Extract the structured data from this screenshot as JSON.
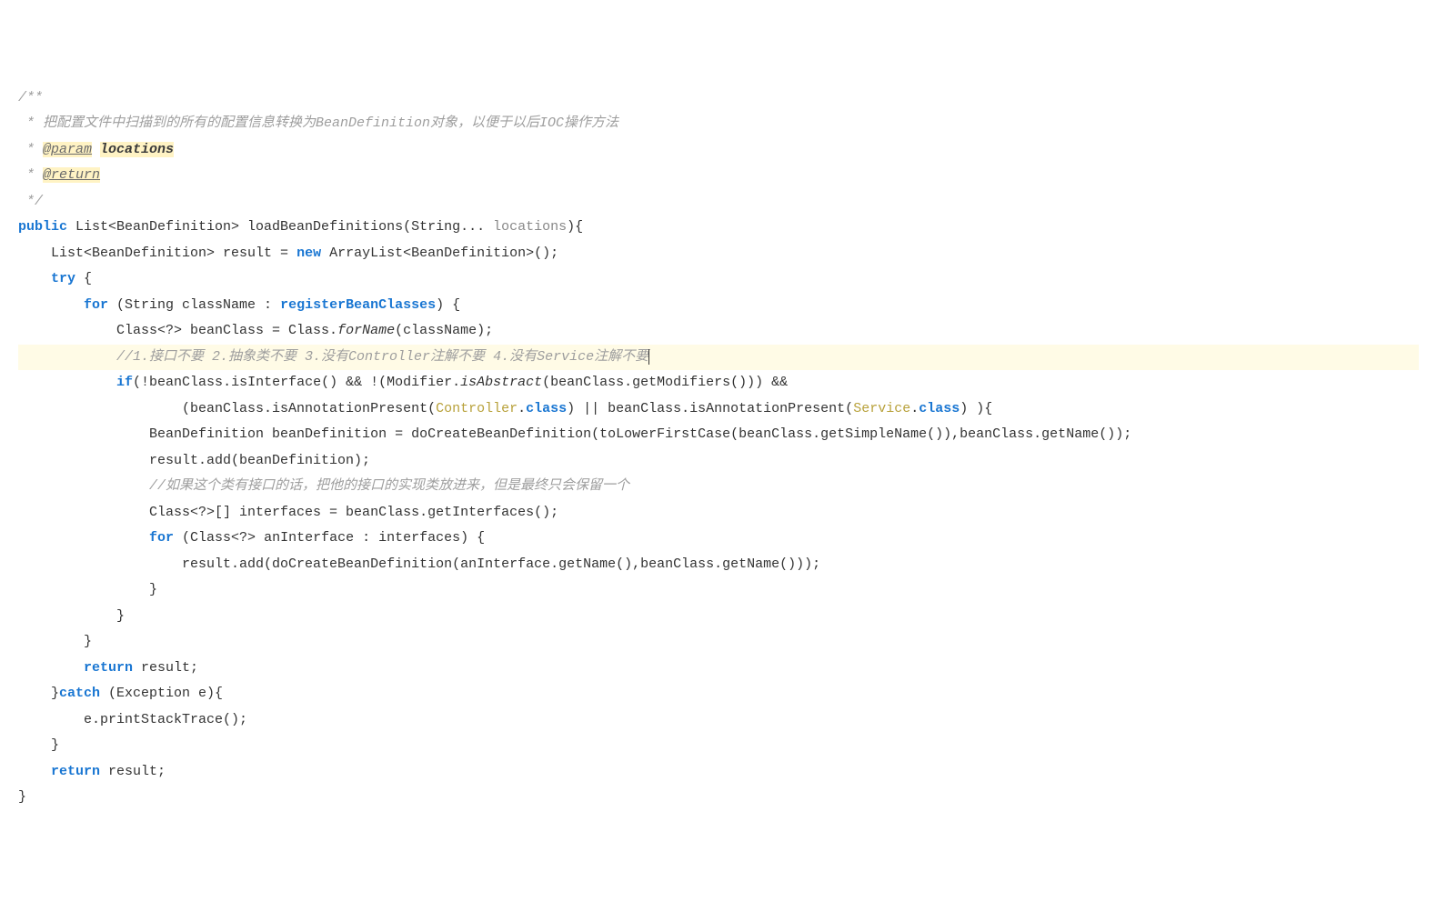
{
  "lines": {
    "l1": "/**",
    "l2_star": " * ",
    "l2_text": "把配置文件中扫描到的所有的配置信息转换为BeanDefinition对象，以便于以后IOC操作方法",
    "l3_star": " * ",
    "l3_tag": "@param",
    "l3_sp": " ",
    "l3_param": "locations",
    "l4_star": " * ",
    "l4_tag": "@return",
    "l5": " */",
    "l6_kw": "public",
    "l6_a": " List<BeanDefinition> loadBeanDefinitions(String... ",
    "l6_p": "locations",
    "l6_b": "){",
    "l7_a": "    List<BeanDefinition> result = ",
    "l7_new": "new",
    "l7_b": " ArrayList<BeanDefinition>();",
    "l8_a": "    ",
    "l8_try": "try",
    "l8_b": " {",
    "l9_a": "        ",
    "l9_for": "for",
    "l9_b": " (String className : ",
    "l9_reg": "registerBeanClasses",
    "l9_c": ") {",
    "l10_a": "            Class<?> beanClass = Class.",
    "l10_forname": "forName",
    "l10_b": "(className);",
    "l11_a": "            ",
    "l11_c": "//1.接口不要 2.抽象类不要 3.没有Controller注解不要 4.没有Service注解不要",
    "l12_a": "            ",
    "l12_if": "if",
    "l12_b": "(!beanClass.isInterface() && !(Modifier.",
    "l12_isabs": "isAbstract",
    "l12_c": "(beanClass.getModifiers())) &&",
    "l13_a": "                    (beanClass.isAnnotationPresent(",
    "l13_ctrl": "Controller",
    "l13_b": ".",
    "l13_ck1": "class",
    "l13_c": ") || beanClass.isAnnotationPresent(",
    "l13_svc": "Service",
    "l13_d": ".",
    "l13_ck2": "class",
    "l13_e": ") ){",
    "l14": "                BeanDefinition beanDefinition = doCreateBeanDefinition(toLowerFirstCase(beanClass.getSimpleName()),beanClass.getName());",
    "l15": "                result.add(beanDefinition);",
    "l16_a": "                ",
    "l16_c": "//如果这个类有接口的话，把他的接口的实现类放进来，但是最终只会保留一个",
    "l17": "                Class<?>[] interfaces = beanClass.getInterfaces();",
    "l18_a": "                ",
    "l18_for": "for",
    "l18_b": " (Class<?> anInterface : interfaces) {",
    "l19": "                    result.add(doCreateBeanDefinition(anInterface.getName(),beanClass.getName()));",
    "l20": "                }",
    "l21": "            }",
    "l22": "        }",
    "l23_a": "        ",
    "l23_ret": "return",
    "l23_b": " result;",
    "l24_a": "    }",
    "l24_catch": "catch",
    "l24_b": " (Exception e){",
    "l25": "        e.printStackTrace();",
    "l26": "    }",
    "l27_a": "    ",
    "l27_ret": "return",
    "l27_b": " result;",
    "l28": "}"
  }
}
